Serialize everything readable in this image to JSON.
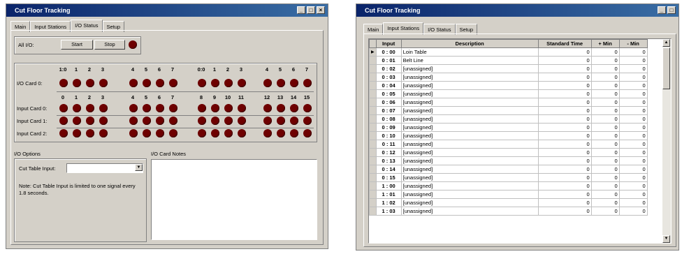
{
  "left_window": {
    "title": "Cut Floor Tracking",
    "title_buttons": [
      "_",
      "□",
      "×"
    ],
    "tabs": [
      {
        "label": "Main"
      },
      {
        "label": "Input Stations"
      },
      {
        "label": "I/O Status"
      },
      {
        "label": "Setup"
      }
    ],
    "all_io_label": "All I/O:",
    "start_label": "Start",
    "stop_label": "Stop",
    "card0_headers": [
      "1:0",
      "1",
      "2",
      "3",
      "4",
      "5",
      "6",
      "7",
      "0:0",
      "1",
      "2",
      "3",
      "4",
      "5",
      "6",
      "7"
    ],
    "input_headers": [
      "0",
      "1",
      "2",
      "3",
      "4",
      "5",
      "6",
      "7",
      "8",
      "9",
      "10",
      "11",
      "12",
      "13",
      "14",
      "15"
    ],
    "rows": [
      {
        "label": "I/O Card 0:"
      },
      {
        "label": "Input Card 0:"
      },
      {
        "label": "Input Card 1:"
      },
      {
        "label": "Input Card 2:"
      }
    ],
    "io_options_label": "I/O Options",
    "io_card_notes_label": "I/O Card Notes",
    "cut_table_input_label": "Cut Table Input:",
    "note_text": "Note:  Cut Table Input is limited to one signal every 1.8 seconds.",
    "led_color": "#6e0000"
  },
  "right_window": {
    "title": "Cut Floor Tracking",
    "title_buttons": [
      "_",
      "□"
    ],
    "tabs": [
      {
        "label": "Main"
      },
      {
        "label": "Input Stations"
      },
      {
        "label": "I/O Status"
      },
      {
        "label": "Setup"
      }
    ],
    "columns": [
      "Input",
      "Description",
      "Standard Time",
      "+ Min",
      "- Min"
    ],
    "rows": [
      {
        "marker": "▶",
        "input": "0 : 00",
        "description": "Loin Table",
        "standard_time": "0",
        "plus_min": "0",
        "minus_min": "0"
      },
      {
        "marker": "",
        "input": "0 : 01",
        "description": "Belt Line",
        "standard_time": "0",
        "plus_min": "0",
        "minus_min": "0"
      },
      {
        "marker": "",
        "input": "0 : 02",
        "description": "[unassigned]",
        "standard_time": "0",
        "plus_min": "0",
        "minus_min": "0"
      },
      {
        "marker": "",
        "input": "0 : 03",
        "description": "[unassigned]",
        "standard_time": "0",
        "plus_min": "0",
        "minus_min": "0"
      },
      {
        "marker": "",
        "input": "0 : 04",
        "description": "[unassigned]",
        "standard_time": "0",
        "plus_min": "0",
        "minus_min": "0"
      },
      {
        "marker": "",
        "input": "0 : 05",
        "description": "[unassigned]",
        "standard_time": "0",
        "plus_min": "0",
        "minus_min": "0"
      },
      {
        "marker": "",
        "input": "0 : 06",
        "description": "[unassigned]",
        "standard_time": "0",
        "plus_min": "0",
        "minus_min": "0"
      },
      {
        "marker": "",
        "input": "0 : 07",
        "description": "[unassigned]",
        "standard_time": "0",
        "plus_min": "0",
        "minus_min": "0"
      },
      {
        "marker": "",
        "input": "0 : 08",
        "description": "[unassigned]",
        "standard_time": "0",
        "plus_min": "0",
        "minus_min": "0"
      },
      {
        "marker": "",
        "input": "0 : 09",
        "description": "[unassigned]",
        "standard_time": "0",
        "plus_min": "0",
        "minus_min": "0"
      },
      {
        "marker": "",
        "input": "0 : 10",
        "description": "[unassigned]",
        "standard_time": "0",
        "plus_min": "0",
        "minus_min": "0"
      },
      {
        "marker": "",
        "input": "0 : 11",
        "description": "[unassigned]",
        "standard_time": "0",
        "plus_min": "0",
        "minus_min": "0"
      },
      {
        "marker": "",
        "input": "0 : 12",
        "description": "[unassigned]",
        "standard_time": "0",
        "plus_min": "0",
        "minus_min": "0"
      },
      {
        "marker": "",
        "input": "0 : 13",
        "description": "[unassigned]",
        "standard_time": "0",
        "plus_min": "0",
        "minus_min": "0"
      },
      {
        "marker": "",
        "input": "0 : 14",
        "description": "[unassigned]",
        "standard_time": "0",
        "plus_min": "0",
        "minus_min": "0"
      },
      {
        "marker": "",
        "input": "0 : 15",
        "description": "[unassigned]",
        "standard_time": "0",
        "plus_min": "0",
        "minus_min": "0"
      },
      {
        "marker": "",
        "input": "1 : 00",
        "description": "[unassigned]",
        "standard_time": "0",
        "plus_min": "0",
        "minus_min": "0"
      },
      {
        "marker": "",
        "input": "1 : 01",
        "description": "[unassigned]",
        "standard_time": "0",
        "plus_min": "0",
        "minus_min": "0"
      },
      {
        "marker": "",
        "input": "1 : 02",
        "description": "[unassigned]",
        "standard_time": "0",
        "plus_min": "0",
        "minus_min": "0"
      },
      {
        "marker": "",
        "input": "1 : 03",
        "description": "[unassigned]",
        "standard_time": "0",
        "plus_min": "0",
        "minus_min": "0"
      }
    ]
  }
}
